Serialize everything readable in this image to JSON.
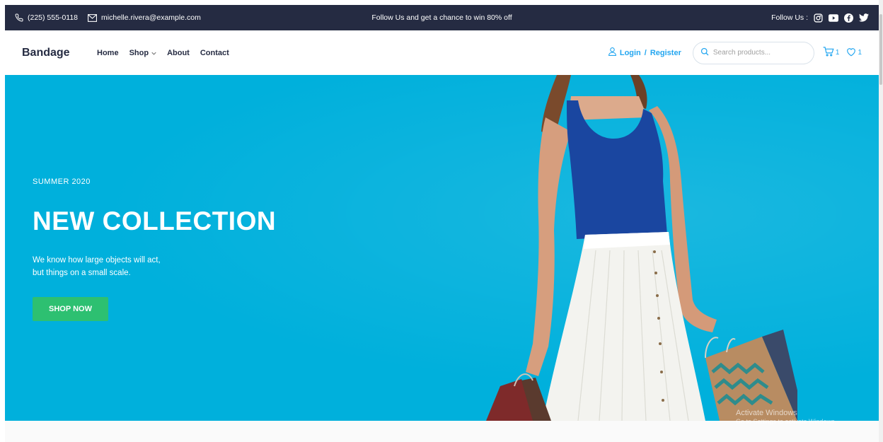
{
  "topbar": {
    "phone": "(225) 555-0118",
    "email": "michelle.rivera@example.com",
    "promo": "Follow Us and get a chance to win 80% off",
    "follow_label": "Follow Us :",
    "socials": [
      "instagram-icon",
      "youtube-icon",
      "facebook-icon",
      "twitter-icon"
    ]
  },
  "header": {
    "brand": "Bandage",
    "nav": {
      "home": "Home",
      "shop": "Shop",
      "about": "About",
      "contact": "Contact"
    },
    "login": "Login",
    "separator": "/",
    "register": "Register",
    "search_placeholder": "Search products...",
    "cart_count": "1",
    "wishlist_count": "1"
  },
  "hero": {
    "season": "SUMMER 2020",
    "headline": "NEW COLLECTION",
    "desc_line1": "We know how large objects will act,",
    "desc_line2": "but things on a small scale.",
    "cta": "SHOP NOW"
  },
  "watermark": {
    "line1": "Activate Windows",
    "line2": "Go to Settings to activate Windows."
  },
  "colors": {
    "dark": "#252b42",
    "accent_blue": "#23a6f0",
    "hero_bg": "#00b0dc",
    "cta_green": "#2dc071"
  }
}
